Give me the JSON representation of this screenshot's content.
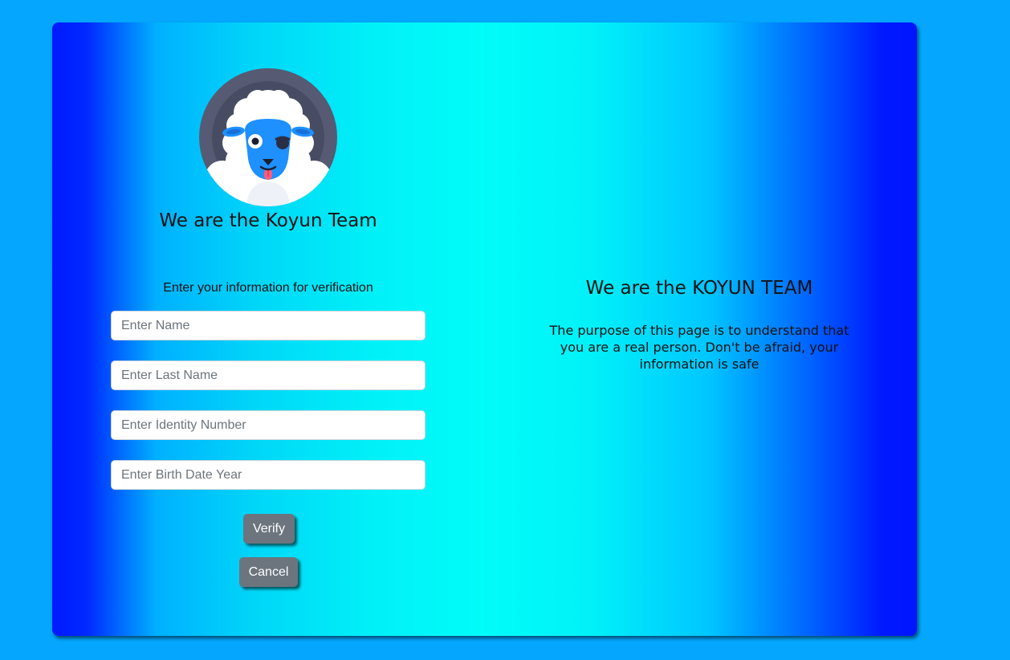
{
  "left": {
    "logo_icon": "sheep-avatar-icon",
    "title": "We are the Koyun Team",
    "form_intro": "Enter your information for verification",
    "fields": {
      "name_placeholder": "Enter Name",
      "last_name_placeholder": "Enter Last Name",
      "identity_placeholder": "Enter İdentity Number",
      "birth_year_placeholder": "Enter Birth Date Year"
    },
    "buttons": {
      "verify": "Verify",
      "cancel": "Cancel"
    }
  },
  "right": {
    "title": "We are the KOYUN TEAM",
    "description": "The purpose of this page is to understand that you are a real person. Don't be afraid, your information is safe"
  },
  "colors": {
    "page_background": "#04a7fd",
    "button": "#6c757d"
  }
}
